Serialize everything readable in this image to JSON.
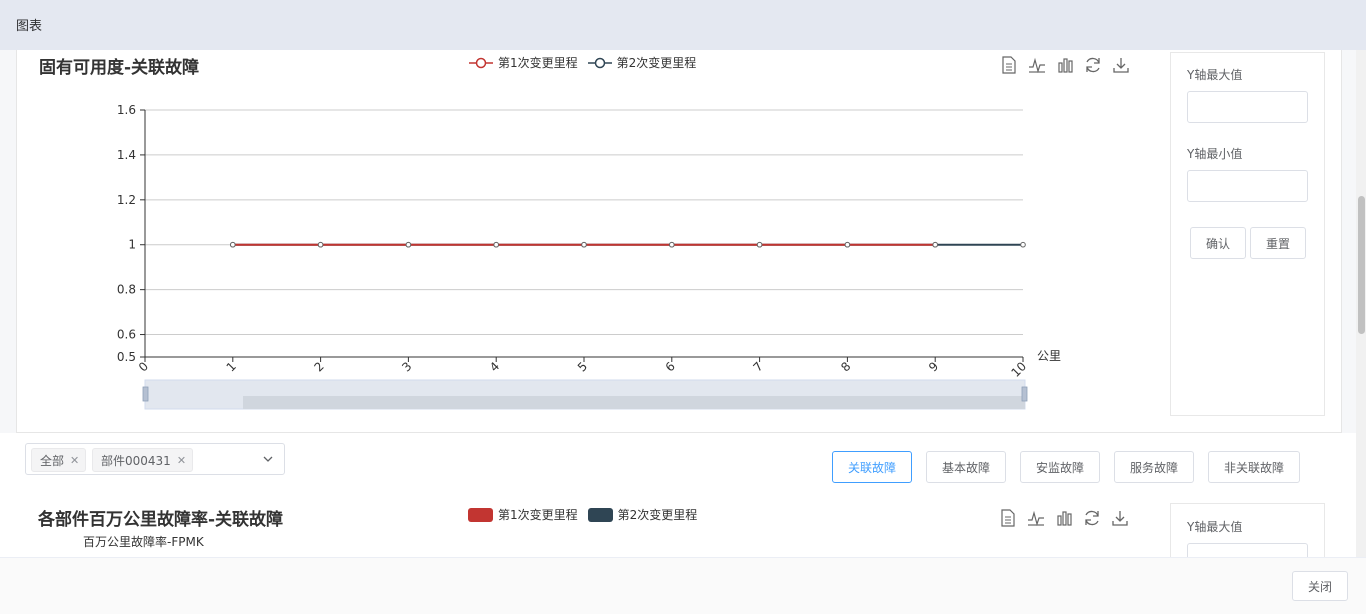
{
  "header": {
    "title": "图表"
  },
  "chart1": {
    "title": "固有可用度-关联故障",
    "legend": [
      "第1次变更里程",
      "第2次变更里程"
    ]
  },
  "chart_data": [
    {
      "type": "line",
      "title": "固有可用度-关联故障",
      "xlabel": "公里",
      "ylabel": "",
      "x": [
        0,
        1,
        2,
        3,
        4,
        5,
        6,
        7,
        8,
        9,
        10
      ],
      "x_ticks": [
        "0",
        "1",
        "2",
        "3",
        "4",
        "5",
        "6",
        "7",
        "8",
        "9",
        "10"
      ],
      "y_ticks": [
        "0.5",
        "0.6",
        "0.8",
        "1",
        "1.2",
        "1.4",
        "1.6"
      ],
      "ylim": [
        0.5,
        1.6
      ],
      "grid": true,
      "legend_position": "top-center",
      "series": [
        {
          "name": "第1次变更里程",
          "color": "#c23531",
          "x": [
            1,
            2,
            3,
            4,
            5,
            6,
            7,
            8,
            9
          ],
          "values": [
            1,
            1,
            1,
            1,
            1,
            1,
            1,
            1,
            1
          ]
        },
        {
          "name": "第2次变更里程",
          "color": "#2f4554",
          "x": [
            1,
            2,
            3,
            4,
            5,
            6,
            7,
            8,
            9,
            10
          ],
          "values": [
            1,
            1,
            1,
            1,
            1,
            1,
            1,
            1,
            1,
            1
          ]
        }
      ]
    },
    {
      "type": "bar",
      "title": "各部件百万公里故障率-关联故障",
      "ylabel": "百万公里故障率-FPMK",
      "legend_position": "top-center",
      "series": [
        {
          "name": "第1次变更里程",
          "color": "#c23531"
        },
        {
          "name": "第2次变更里程",
          "color": "#2f4554"
        }
      ]
    }
  ],
  "chart2": {
    "title": "各部件百万公里故障率-关联故障",
    "ylabel": "百万公里故障率-FPMK",
    "legend": [
      "第1次变更里程",
      "第2次变更里程"
    ]
  },
  "colors": {
    "series1": "#c23531",
    "series2": "#2f4554",
    "accent": "#409eff"
  },
  "toolbox_icons": [
    "data-view-icon",
    "line-chart-icon",
    "bar-chart-icon",
    "refresh-icon",
    "download-icon"
  ],
  "yform": {
    "max_label": "Y轴最大值",
    "min_label": "Y轴最小值",
    "max_value": "",
    "min_value": "",
    "confirm": "确认",
    "reset": "重置"
  },
  "filter": {
    "tags": [
      "全部",
      "部件000431"
    ],
    "tabs": [
      "关联故障",
      "基本故障",
      "安监故障",
      "服务故障",
      "非关联故障"
    ],
    "active_tab": "关联故障"
  },
  "footer": {
    "close": "关闭"
  }
}
